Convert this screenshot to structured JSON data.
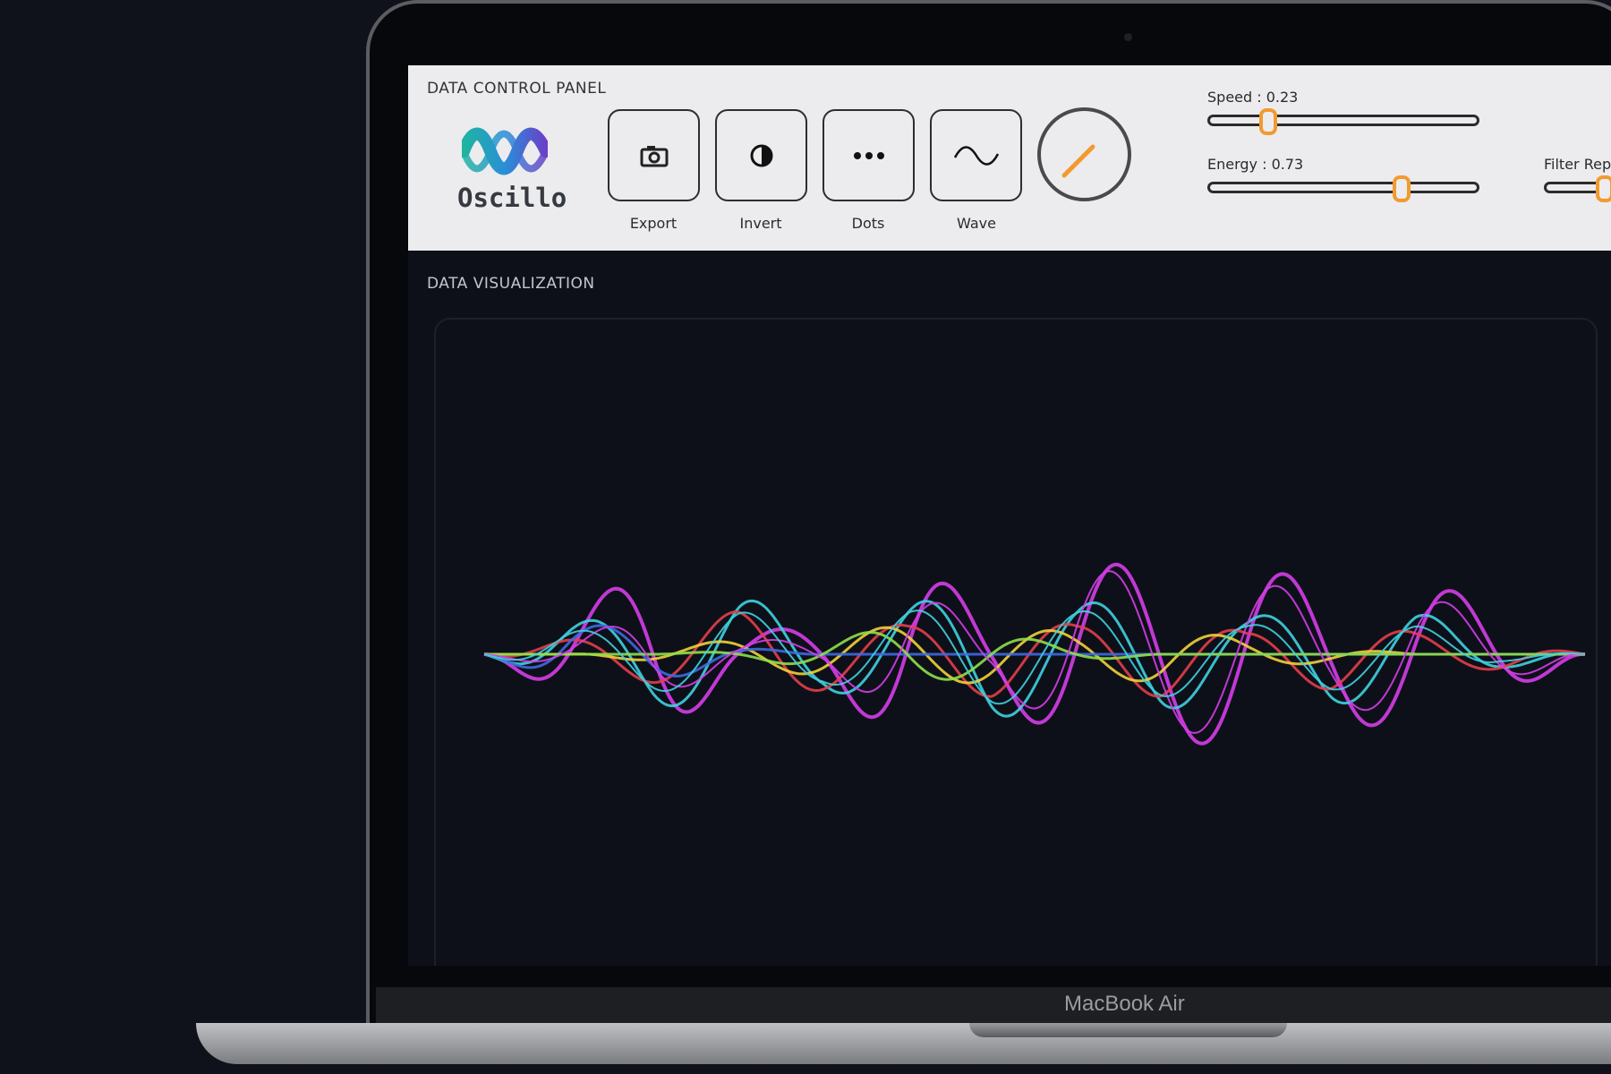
{
  "control_panel": {
    "title": "DATA CONTROL PANEL",
    "logo_text": "Oscillo",
    "buttons": [
      {
        "label": "Export",
        "icon": "camera-icon"
      },
      {
        "label": "Invert",
        "icon": "contrast-icon"
      },
      {
        "label": "Dots",
        "icon": "dots-icon"
      },
      {
        "label": "Wave",
        "icon": "wave-icon"
      }
    ],
    "sliders": [
      {
        "label": "Speed : 0.23",
        "value": 0.23
      },
      {
        "label": "Energy : 0.73",
        "value": 0.73
      },
      {
        "label": "Filter Repe",
        "value": 0.2
      }
    ],
    "accent": "#f39a2e"
  },
  "visualization": {
    "title": "DATA VISUALIZATION",
    "series_colors": [
      "#d43ee8",
      "#3fd1e0",
      "#e23f4a",
      "#f0d23a",
      "#3c6ae0",
      "#8ee04a"
    ]
  },
  "device": {
    "brand": "MacBook Air"
  }
}
